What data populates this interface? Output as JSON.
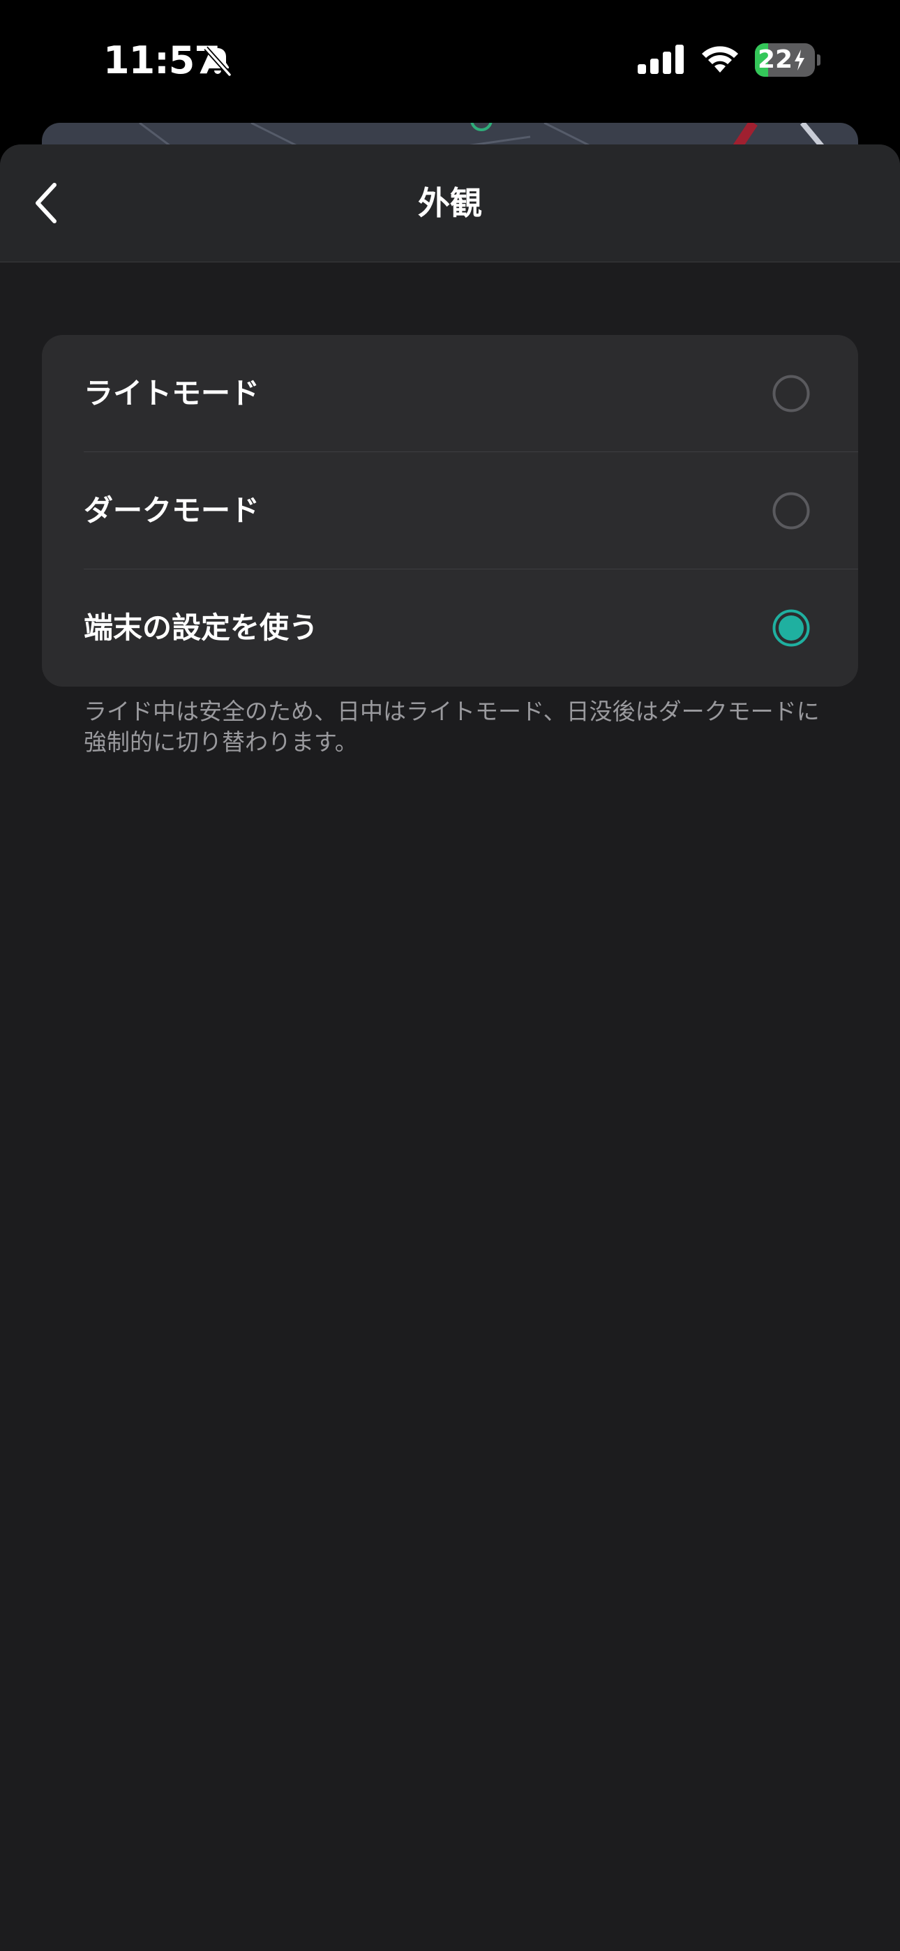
{
  "status_bar": {
    "time": "11:57",
    "battery_level": "22",
    "battery_fraction": 0.22,
    "icons": [
      "bell-slash-icon",
      "cellular-signal-icon",
      "wifi-icon",
      "battery-charging-icon"
    ]
  },
  "nav": {
    "title": "外観",
    "back_icon": "chevron-left-icon"
  },
  "appearance_options": [
    {
      "label": "ライトモード",
      "selected": false
    },
    {
      "label": "ダークモード",
      "selected": false
    },
    {
      "label": "端末の設定を使う",
      "selected": true
    }
  ],
  "footnote": "ライド中は安全のため、日中はライトモード、日没後はダークモードに強制的に切り替わります。",
  "colors": {
    "accent": "#1fb0a0",
    "sheet_background": "#1c1c1e",
    "card_background": "#2c2c2e",
    "nav_background": "#262729",
    "battery_green": "#34c759"
  }
}
